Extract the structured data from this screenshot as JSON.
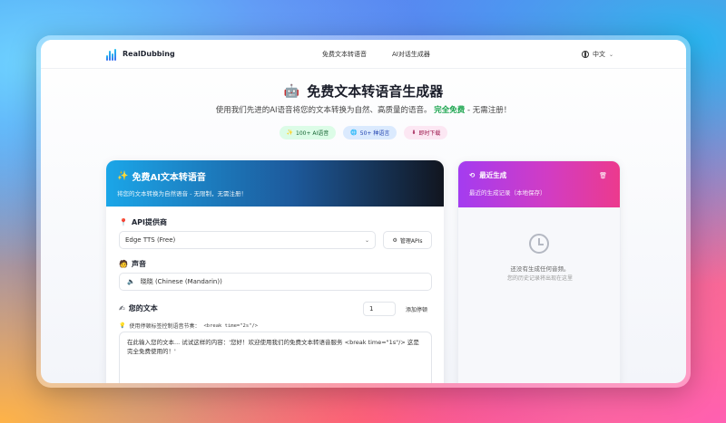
{
  "nav": {
    "brand": "RealDubbing",
    "links": [
      "免费文本转语音",
      "AI对话生成器"
    ],
    "language": "中文"
  },
  "hero": {
    "title": "免费文本转语音生成器",
    "subtitle_prefix": "使用我们先进的AI语音将您的文本转换为自然、高质量的语音。",
    "subtitle_highlight": "完全免费",
    "subtitle_suffix": " - 无需注册！",
    "badges": [
      {
        "icon": "✨",
        "label": "100+ AI语音",
        "icon_name": "sparkle-icon"
      },
      {
        "icon": "🌐",
        "label": "50+ 种语言",
        "icon_name": "globe-icon"
      },
      {
        "icon": "⬇",
        "label": "即时下载",
        "icon_name": "download-icon"
      }
    ]
  },
  "main_card": {
    "title": "免费AI文本转语音",
    "subtitle": "将您的文本转换为自然语音 - 无限制，无需注册！",
    "api_label": "API提供商",
    "api_value": "Edge TTS (Free)",
    "manage_label": "管理APIs",
    "voice_label": "声音",
    "voice_value": "晓晓 (Chinese (Mandarin))",
    "text_label": "您的文本",
    "pause_value": "1",
    "add_pause_label": "添加停顿",
    "tip_text": "使用停顿标签控制语音节奏：",
    "tip_code": "<break time=\"2s\"/>",
    "textarea_text": "在此输入您的文本... 试试这样的内容：'您好！欢迎使用我们的免费文本转语音服务 <break time=\"1s\"/> 这是完全免费使用的！'"
  },
  "side_card": {
    "title": "最近生成",
    "subtitle": "最近的生成记录（本地保存）",
    "empty_title": "还没有生成任何音频。",
    "empty_hint": "您的历史记录将出现在这里"
  },
  "colors": {
    "main_header_start": "#1ba6e8",
    "main_header_end": "#11151f",
    "side_header_start": "#a43cf0",
    "side_header_end": "#ec3a8d",
    "highlight": "#16a34a"
  }
}
